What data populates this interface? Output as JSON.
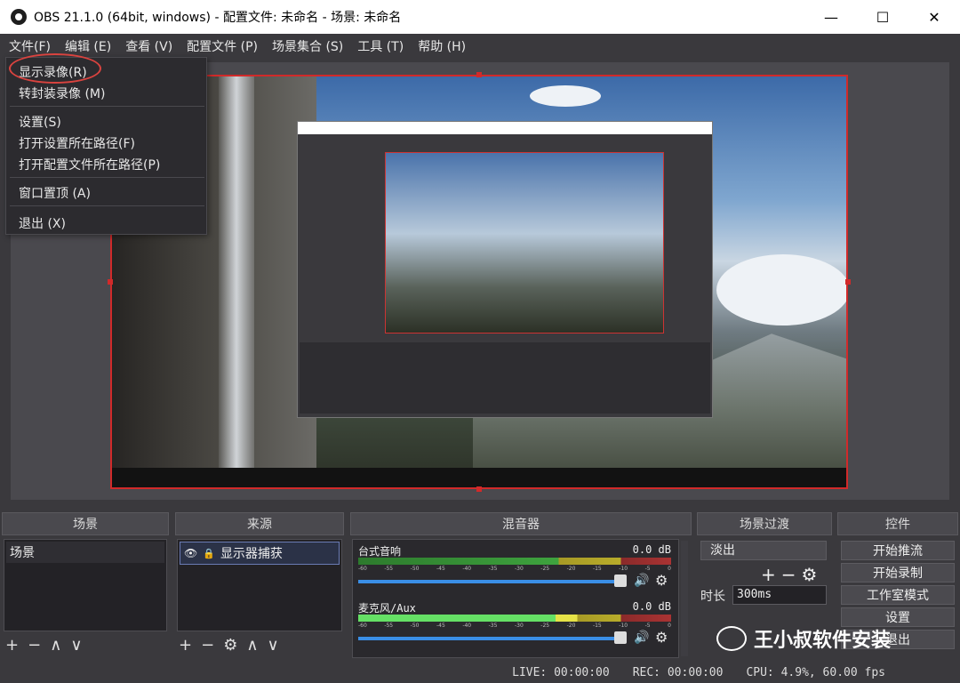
{
  "titlebar": {
    "title": "OBS 21.1.0 (64bit, windows) - 配置文件: 未命名 - 场景: 未命名",
    "minimize": "—",
    "maximize": "☐",
    "close": "✕"
  },
  "menubar": {
    "items": [
      "文件(F)",
      "编辑 (E)",
      "查看 (V)",
      "配置文件 (P)",
      "场景集合 (S)",
      "工具 (T)",
      "帮助 (H)"
    ]
  },
  "file_menu": {
    "items": [
      "显示录像(R)",
      "转封装录像 (M)",
      "设置(S)",
      "打开设置所在路径(F)",
      "打开配置文件所在路径(P)",
      "窗口置顶 (A)",
      "退出 (X)"
    ]
  },
  "panels": {
    "scenes": {
      "title": "场景",
      "items": [
        "场景"
      ]
    },
    "sources": {
      "title": "来源",
      "items": [
        "显示器捕获"
      ]
    },
    "mixer": {
      "title": "混音器",
      "channels": [
        {
          "name": "台式音响",
          "db": "0.0 dB"
        },
        {
          "name": "麦克风/Aux",
          "db": "0.0 dB"
        }
      ],
      "scale": [
        "-60",
        "-55",
        "-50",
        "-45",
        "-40",
        "-35",
        "-30",
        "-25",
        "-20",
        "-15",
        "-10",
        "-5",
        "0"
      ]
    },
    "transitions": {
      "title": "场景过渡",
      "selected": "淡出",
      "duration_label": "时长",
      "duration_value": "300ms"
    },
    "controls": {
      "title": "控件",
      "buttons": [
        "开始推流",
        "开始录制",
        "工作室模式",
        "设置",
        "退出"
      ]
    }
  },
  "statusbar": {
    "live": "LIVE: 00:00:00",
    "rec": "REC: 00:00:00",
    "cpu": "CPU: 4.9%, 60.00 fps"
  },
  "watermark": {
    "text": "王小叔软件安装"
  },
  "colors": {
    "accent_red": "#d12a2a",
    "circle_red": "#d9433f",
    "fader_blue": "#3a8ee6"
  }
}
